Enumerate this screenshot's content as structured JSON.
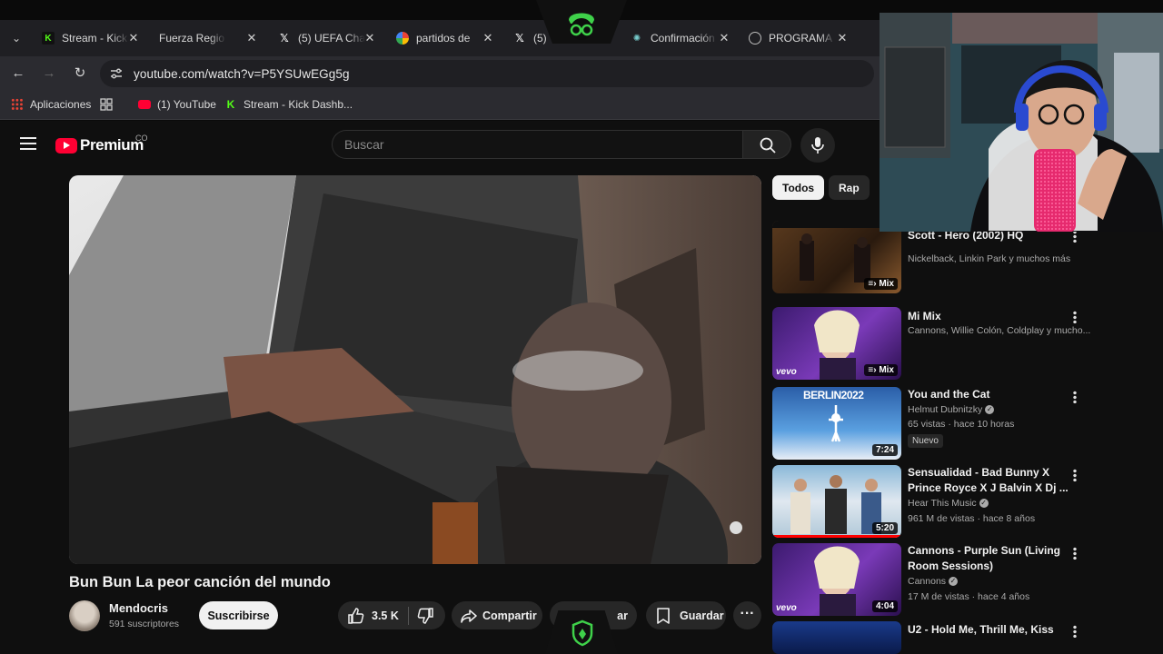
{
  "browser": {
    "tabs": [
      {
        "title": "Stream - Kick",
        "icon": "kick-icon"
      },
      {
        "title": "Fuerza Regio",
        "icon": "youtube-icon"
      },
      {
        "title": "(5) UEFA Cha",
        "icon": "x-icon"
      },
      {
        "title": "partidos de",
        "icon": "google-icon"
      },
      {
        "title": "(5)",
        "icon": "x-icon"
      },
      {
        "title": "Confirmación",
        "icon": "confirmation-icon"
      },
      {
        "title": "PROGRAMA",
        "icon": "globe-icon"
      }
    ],
    "url": "youtube.com/watch?v=P5YSUwEGg5g",
    "bookmarks": [
      {
        "label": "Aplicaciones",
        "icon": "apps-grid-icon"
      },
      {
        "label": "",
        "icon": "grid-icon"
      },
      {
        "label": "(1) YouTube",
        "icon": "youtube-icon"
      },
      {
        "label": "Stream - Kick Dashb...",
        "icon": "kick-icon"
      }
    ]
  },
  "youtube": {
    "logo_text": "Premium",
    "country_code": "CO",
    "search_placeholder": "Buscar",
    "video": {
      "title": "Bun Bun La peor canción del mundo",
      "channel": "Mendocris",
      "subscribers": "591 suscriptores",
      "subscribe_label": "Suscribirse",
      "likes": "3.5 K",
      "share_label": "Compartir",
      "save_label": "Guardar",
      "partial_label": "ar"
    },
    "chips": [
      "Todos",
      "Rap"
    ],
    "recommendations": [
      {
        "title": "Scott - Hero (2002) HQ",
        "meta1": "Nickelback, Linkin Park y muchos más",
        "meta2": "",
        "badge": "Mix",
        "new": ""
      },
      {
        "title": "Mi Mix",
        "meta1": "Cannons, Willie Colón, Coldplay y mucho...",
        "meta2": "",
        "badge": "Mix",
        "new": ""
      },
      {
        "title": "You and the Cat",
        "meta1": "Helmut Dubnitzky",
        "meta2": "65 vistas · hace 10 horas",
        "badge": "7:24",
        "new": "Nuevo"
      },
      {
        "title": "Sensualidad - Bad Bunny X Prince Royce X J Balvin X Dj ...",
        "meta1": "Hear This Music",
        "meta2": "961 M de vistas · hace 8 años",
        "badge": "5:20",
        "new": ""
      },
      {
        "title": "Cannons - Purple Sun (Living Room Sessions)",
        "meta1": "Cannons",
        "meta2": "17 M de vistas · hace 4 años",
        "badge": "4:04",
        "new": ""
      },
      {
        "title": "U2 - Hold Me, Thrill Me, Kiss",
        "meta1": "",
        "meta2": "",
        "badge": "",
        "new": ""
      }
    ],
    "thumb_texts": {
      "berlin": "BERLIN2022",
      "vevo": "vevo"
    }
  },
  "colors": {
    "accent": "#ff0033",
    "kick": "#53fc18",
    "bg": "#0f0f0f"
  }
}
